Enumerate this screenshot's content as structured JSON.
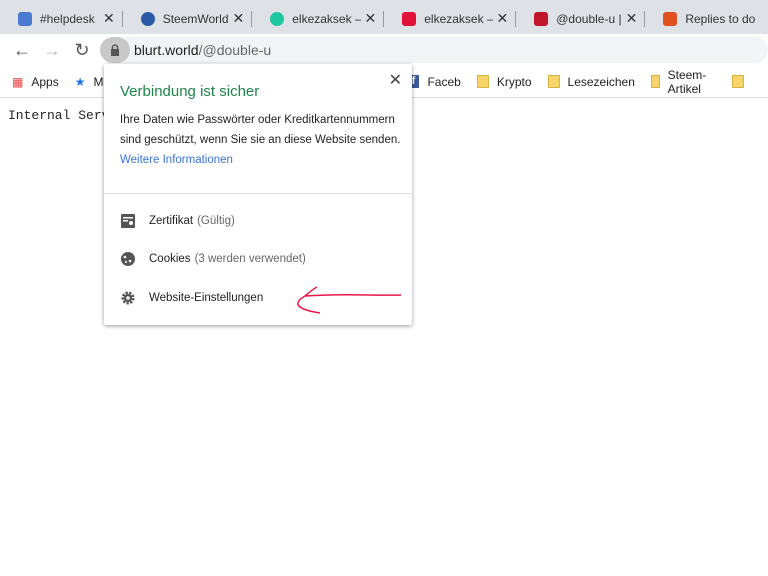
{
  "tabs": [
    {
      "title": "#helpdesk",
      "color": "#4a7bd0"
    },
    {
      "title": "SteemWorld",
      "color": "#2a5aa8"
    },
    {
      "title": "elkezaksek —",
      "color": "#1cc7a0"
    },
    {
      "title": "elkezaksek —",
      "color": "#e31337"
    },
    {
      "title": "@double-u |",
      "color": "#c0152b"
    },
    {
      "title": "Replies to do",
      "color": "#e05020"
    }
  ],
  "toolbar": {
    "url_host": "blurt.world",
    "url_path": "/@double-u"
  },
  "bookmarks": [
    {
      "label": "Apps"
    },
    {
      "label": "M"
    },
    {
      "label": "Faceb"
    },
    {
      "label": "Krypto"
    },
    {
      "label": "Lesezeichen"
    },
    {
      "label": "Steem-Artikel"
    }
  ],
  "page": {
    "text": "Internal Serv"
  },
  "popup": {
    "title": "Verbindung ist sicher",
    "description": "Ihre Daten wie Passwörter oder Kreditkartennummern sind geschützt, wenn Sie sie an diese Website senden.",
    "link": "Weitere Informationen",
    "certificate": "Zertifikat",
    "certificate_status": "(Gültig)",
    "cookies": "Cookies",
    "cookies_status": "(3 werden verwendet)",
    "site_settings": "Website-Einstellungen",
    "accent": "#1e8449",
    "annotation_color": "#e8174a"
  }
}
